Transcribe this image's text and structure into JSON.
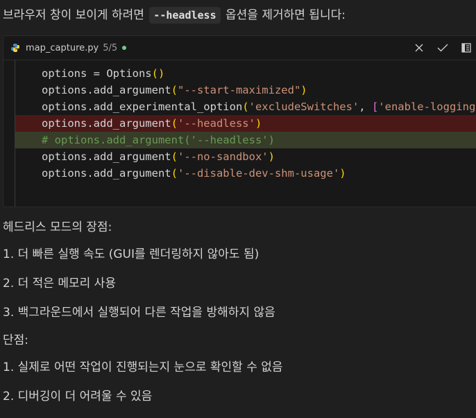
{
  "intro": {
    "before": "브라우저 창이 보이게 하려면 ",
    "code": "--headless",
    "after": " 옵션을 제거하면 됩니다:"
  },
  "codeblock": {
    "filename": "map_capture.py",
    "count": "5/5",
    "lines": [
      {
        "type": "normal",
        "text": "options = Options()"
      },
      {
        "type": "normal",
        "text": "options.add_argument(\"--start-maximized\")"
      },
      {
        "type": "normal",
        "text": "options.add_experimental_option('excludeSwitches', ['enable-logging'])"
      },
      {
        "type": "del",
        "text": "options.add_argument('--headless')"
      },
      {
        "type": "ins",
        "text": "# options.add_argument('--headless')"
      },
      {
        "type": "normal",
        "text": "options.add_argument('--no-sandbox')"
      },
      {
        "type": "normal",
        "text": "options.add_argument('--disable-dev-shm-usage')"
      }
    ],
    "icons": [
      "close-icon",
      "check-icon",
      "diff-icon"
    ]
  },
  "content": {
    "advantages_title": "헤드리스 모드의 장점:",
    "advantages": [
      "1. 더 빠른 실행 속도 (GUI를 렌더링하지 않아도 됨)",
      "2. 더 적은 메모리 사용",
      "3. 백그라운드에서 실행되어 다른 작업을 방해하지 않음"
    ],
    "disadvantages_title": "단점:",
    "disadvantages": [
      "1. 실제로 어떤 작업이 진행되는지 눈으로 확인할 수 없음",
      "2. 디버깅이 더 어려울 수 있음"
    ]
  }
}
